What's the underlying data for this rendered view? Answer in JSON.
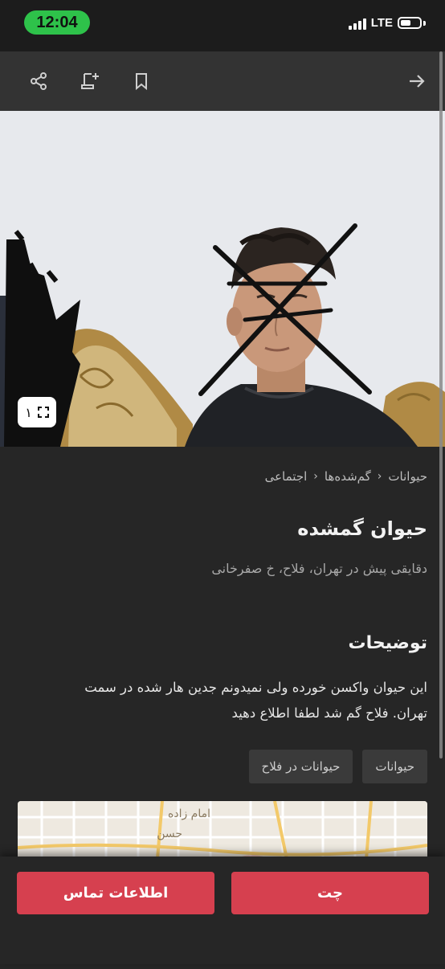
{
  "status_bar": {
    "time": "12:04",
    "network": "LTE"
  },
  "toolbar": {
    "icons": [
      "share-icon",
      "add-note-icon",
      "bookmark-icon",
      "back-arrow-icon"
    ]
  },
  "gallery": {
    "counter": "۱"
  },
  "breadcrumb": {
    "items": [
      "اجتماعی",
      "گم‌شده‌ها",
      "حیوانات"
    ]
  },
  "listing": {
    "title": "حیوان گمشده",
    "meta": "دقایقی پیش در تهران، فلاح، خ صفرخانی",
    "description_heading": "توضیحات",
    "description": "این حیوان واکسن خورده ولی نمیدونم جدین هار شده در سمت تهران. فلاح گم شد لطفا اطلاع دهید",
    "tags": [
      "حیوانات",
      "حیوانات در فلاح"
    ]
  },
  "map": {
    "labels": [
      "امام زاده",
      "حسن"
    ]
  },
  "actions": {
    "chat": "چت",
    "contact": "اطلاعات تماس"
  },
  "colors": {
    "accent": "#d6404f",
    "background": "#262626",
    "toolbar": "#333333"
  }
}
